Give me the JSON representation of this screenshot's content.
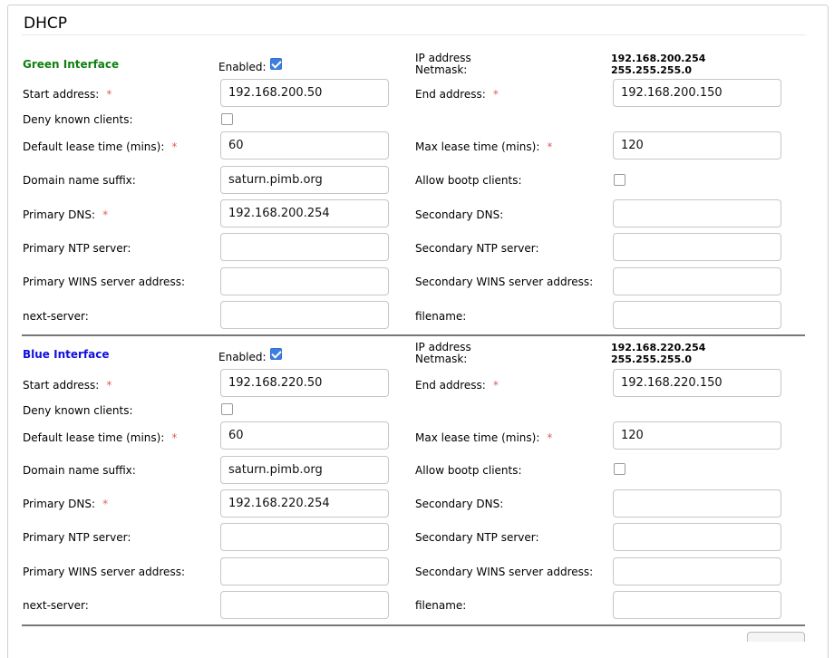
{
  "page": {
    "title": "DHCP"
  },
  "interfaces": [
    {
      "name": "Green Interface",
      "color": "#108010",
      "enabled_label": "Enabled:",
      "enabled": true,
      "ip_label": "IP address",
      "netmask_label": "Netmask:",
      "ip_value": "192.168.200.254",
      "netmask_value": "255.255.255.0",
      "start_label": "Start address:",
      "start_value": "192.168.200.50",
      "end_label": "End address:",
      "end_value": "192.168.200.150",
      "deny_label": "Deny known clients:",
      "deny_checked": false,
      "default_lease_label": "Default lease time (mins):",
      "default_lease_value": "60",
      "max_lease_label": "Max lease time (mins):",
      "max_lease_value": "120",
      "domain_label": "Domain name suffix:",
      "domain_value": "saturn.pimb.org",
      "bootp_label": "Allow bootp clients:",
      "bootp_checked": false,
      "primary_dns_label": "Primary DNS:",
      "primary_dns_value": "192.168.200.254",
      "secondary_dns_label": "Secondary DNS:",
      "secondary_dns_value": "",
      "primary_ntp_label": "Primary NTP server:",
      "primary_ntp_value": "",
      "secondary_ntp_label": "Secondary NTP server:",
      "secondary_ntp_value": "",
      "primary_wins_label": "Primary WINS server address:",
      "primary_wins_value": "",
      "secondary_wins_label": "Secondary WINS server address:",
      "secondary_wins_value": "",
      "next_server_label": "next-server:",
      "next_server_value": "",
      "filename_label": "filename:",
      "filename_value": ""
    },
    {
      "name": "Blue Interface",
      "color": "#1010e0",
      "enabled_label": "Enabled:",
      "enabled": true,
      "ip_label": "IP address",
      "netmask_label": "Netmask:",
      "ip_value": "192.168.220.254",
      "netmask_value": "255.255.255.0",
      "start_label": "Start address:",
      "start_value": "192.168.220.50",
      "end_label": "End address:",
      "end_value": "192.168.220.150",
      "deny_label": "Deny known clients:",
      "deny_checked": false,
      "default_lease_label": "Default lease time (mins):",
      "default_lease_value": "60",
      "max_lease_label": "Max lease time (mins):",
      "max_lease_value": "120",
      "domain_label": "Domain name suffix:",
      "domain_value": "saturn.pimb.org",
      "bootp_label": "Allow bootp clients:",
      "bootp_checked": false,
      "primary_dns_label": "Primary DNS:",
      "primary_dns_value": "192.168.220.254",
      "secondary_dns_label": "Secondary DNS:",
      "secondary_dns_value": "",
      "primary_ntp_label": "Primary NTP server:",
      "primary_ntp_value": "",
      "secondary_ntp_label": "Secondary NTP server:",
      "secondary_ntp_value": "",
      "primary_wins_label": "Primary WINS server address:",
      "primary_wins_value": "",
      "secondary_wins_label": "Secondary WINS server address:",
      "secondary_wins_value": "",
      "next_server_label": "next-server:",
      "next_server_value": "",
      "filename_label": "filename:",
      "filename_value": ""
    }
  ],
  "required_mark": "*"
}
